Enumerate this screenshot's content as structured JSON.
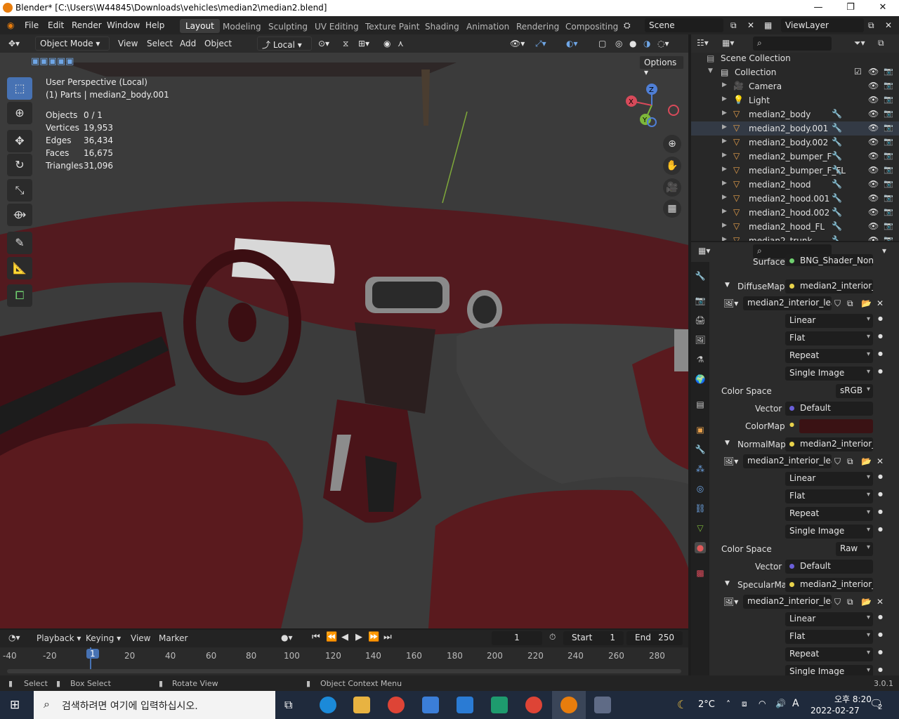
{
  "window": {
    "title": "Blender* [C:\\Users\\W44845\\Downloads\\vehicles\\median2\\median2.blend]"
  },
  "menu": [
    "File",
    "Edit",
    "Render",
    "Window",
    "Help"
  ],
  "workspaces": [
    "Layout",
    "Modeling",
    "Sculpting",
    "UV Editing",
    "Texture Paint",
    "Shading",
    "Animation",
    "Rendering",
    "Compositing"
  ],
  "scene": {
    "name": "Scene",
    "view_layer": "ViewLayer"
  },
  "viewport": {
    "mode": "Object Mode",
    "menus": [
      "View",
      "Select",
      "Add",
      "Object"
    ],
    "transform_orientation": "Local",
    "options_label": "Options",
    "perspective": "User Perspective (Local)",
    "context": "(1) Parts | median2_body.001",
    "stats": [
      {
        "label": "Objects",
        "value": "0 / 1"
      },
      {
        "label": "Vertices",
        "value": "19,953"
      },
      {
        "label": "Edges",
        "value": "36,434"
      },
      {
        "label": "Faces",
        "value": "16,675"
      },
      {
        "label": "Triangles",
        "value": "31,096"
      }
    ],
    "gizmo": {
      "x": "X",
      "y": "Y",
      "z": "Z"
    }
  },
  "outliner": {
    "root": "Scene Collection",
    "collection": "Collection",
    "items": [
      "Camera",
      "Light",
      "median2_body",
      "median2_body.001",
      "median2_body.002",
      "median2_bumper_F",
      "median2_bumper_F_FL",
      "median2_hood",
      "median2_hood.001",
      "median2_hood.002",
      "median2_hood_FL",
      "median2_trunk"
    ]
  },
  "properties": {
    "surface_label": "Surface",
    "surface_value": "BNG_Shader_NonO...",
    "sections": [
      {
        "name": "DiffuseMap",
        "link": "median2_interior_l...",
        "image": "median2_interior_lea...",
        "interp": "Linear",
        "proj": "Flat",
        "ext": "Repeat",
        "src": "Single Image",
        "color_space": "sRGB",
        "vector": "Default",
        "extra_label": "ColorMap"
      },
      {
        "name": "NormalMap",
        "link": "median2_interior_l...",
        "image": "median2_interior_lea...",
        "interp": "Linear",
        "proj": "Flat",
        "ext": "Repeat",
        "src": "Single Image",
        "color_space": "Raw",
        "vector": "Default"
      },
      {
        "name": "SpecularMa",
        "link": "median2_interior_l...",
        "image": "median2_interior_lea...",
        "interp": "Linear",
        "proj": "Flat",
        "ext": "Repeat",
        "src": "Single Image"
      }
    ],
    "color_space_label": "Color Space",
    "vector_label": "Vector",
    "colormap_color": "#3a1214"
  },
  "timeline": {
    "menus": [
      "Playback",
      "Keying",
      "View",
      "Marker"
    ],
    "current_frame": "1",
    "start_label": "Start",
    "start": "1",
    "end_label": "End",
    "end": "250",
    "ticks": [
      "-40",
      "-20",
      "1",
      "20",
      "40",
      "60",
      "80",
      "100",
      "120",
      "140",
      "160",
      "180",
      "200",
      "220",
      "240",
      "260",
      "280"
    ]
  },
  "status": {
    "select": "Select",
    "box_select": "Box Select",
    "rotate": "Rotate View",
    "context_menu": "Object Context Menu",
    "version": "3.0.1"
  },
  "taskbar": {
    "search_placeholder": "검색하려면 여기에 입력하십시오.",
    "temp": "2°C",
    "ime": "A",
    "time": "오후 8:20",
    "date": "2022-02-27",
    "notifications": "2"
  },
  "colors": {
    "accent": "#4772b3",
    "interior": "#5a1a1e",
    "mesh_icon": "#e8a14b"
  }
}
